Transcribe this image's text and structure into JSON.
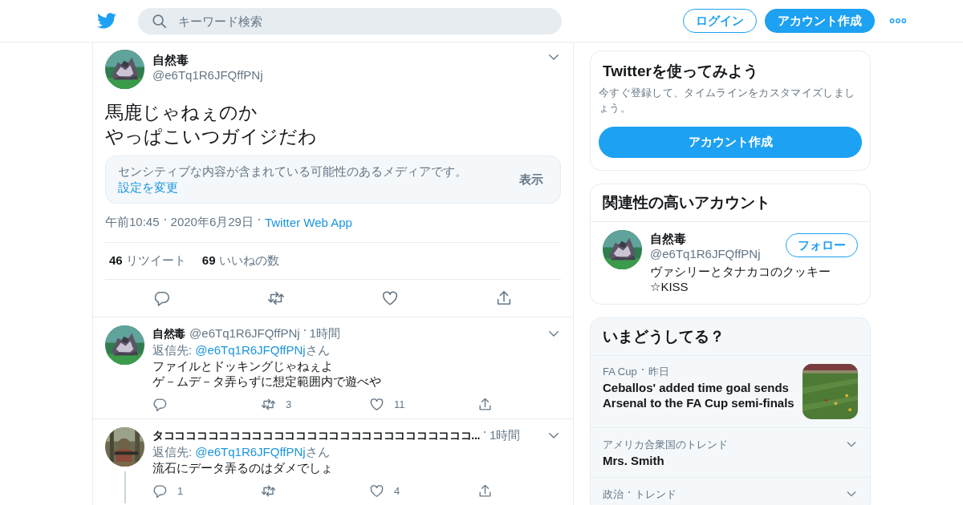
{
  "header": {
    "search": {
      "placeholder": "キーワード検索"
    },
    "login_button": "ログイン",
    "signup_button": "アカウント作成"
  },
  "main_tweet": {
    "avatar": {
      "kind": "picture"
    },
    "name": "自然毒",
    "handle": "@e6Tq1R6JFQffPNj",
    "text": [
      "馬鹿じゃねぇのか",
      "やっぱこいつガイジだわ"
    ],
    "sensitive_notice": {
      "text": "センシティブな内容が含まれている可能性のあるメディアです。",
      "link": "設定を変更",
      "show_button": "表示"
    },
    "meta": {
      "time": "午前10:45",
      "date": "2020年6月29日",
      "source": "Twitter Web App"
    },
    "stats": [
      {
        "count": "46",
        "label": "リツイート"
      },
      {
        "count": "69",
        "label": "いいねの数"
      }
    ]
  },
  "replies": [
    {
      "avatar": {
        "kind": "picture"
      },
      "name": "自然毒",
      "handle": "@e6Tq1R6JFQffPNj",
      "time": "1時間",
      "reply_to_label": "返信先:",
      "reply_to": "@e6Tq1R6JFQffPNj",
      "reply_suffix": "さん",
      "text": [
        "ファイルとドッキングじゃねぇよ",
        "ゲ－ムデ－タ弄らずに想定範囲内で遊べや"
      ],
      "retweet_count": "3",
      "like_count": "11",
      "thread_line": false
    },
    {
      "avatar": {
        "kind": "picture"
      },
      "name": "タココココココココココココココココココココココココココココ...",
      "time": "1時間",
      "reply_to_label": "返信先:",
      "reply_to": "@e6Tq1R6JFQffPNj",
      "reply_suffix": "さん",
      "text": [
        "流石にデータ弄るのはダメでしょ"
      ],
      "reply_count": "1",
      "like_count": "4",
      "thread_line": true
    }
  ],
  "signup_card": {
    "title": "Twitterを使ってみよう",
    "description": "今すぐ登録して、タイムラインをカスタマイズしましょう。",
    "button": "アカウント作成"
  },
  "related_accounts": {
    "title": "関連性の高いアカウント",
    "accounts": [
      {
        "avatar": {
          "kind": "picture"
        },
        "name": "自然毒",
        "handle": "@e6Tq1R6JFQffPNj",
        "bio": "ヴァシリーとタナカコのクッキー☆KISS",
        "follow_button": "フォロー"
      }
    ]
  },
  "trends": {
    "title": "いまどうしてる？",
    "items": [
      {
        "kind": "news",
        "meta": [
          "FA Cup",
          "昨日"
        ],
        "title": "Ceballos' added time goal sends Arsenal to the FA Cup semi-finals",
        "image": {
          "kind": "picture"
        }
      },
      {
        "kind": "trend",
        "meta": [
          "アメリカ合衆国のトレンド"
        ],
        "title": "Mrs. Smith"
      },
      {
        "kind": "trend",
        "meta": [
          "政治",
          "トレンド"
        ]
      }
    ]
  }
}
